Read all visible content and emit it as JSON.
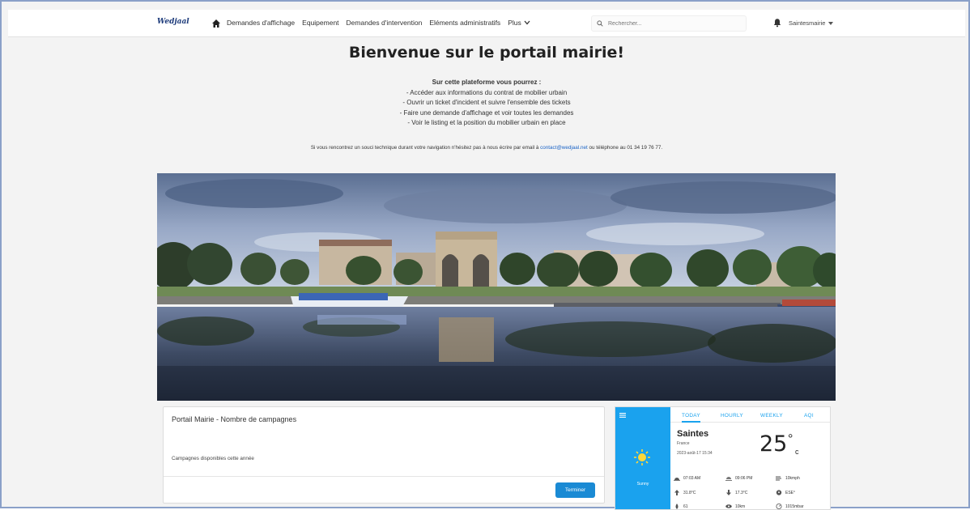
{
  "nav": {
    "logo": "Wedjaal",
    "links": [
      "Demandes d'affichage",
      "Equipement",
      "Demandes d'intervention",
      "Eléments administratifs"
    ],
    "more_label": "Plus",
    "search_placeholder": "Rechercher...",
    "user_label": "Saintesmairie"
  },
  "main": {
    "title": "Bienvenue sur le portail mairie!",
    "intro_lead": "Sur cette plateforme vous pourrez :",
    "intro_items": [
      "- Accéder aux informations du contrat de mobilier urbain",
      "- Ouvrir un ticket d'incident et suivre l'ensemble des tickets",
      "- Faire une demande d'affichage et voir toutes les demandes",
      "- Voir le listing et la position du mobilier urbain en place"
    ],
    "contact_prefix": "Si vous rencontrez un souci technique durant votre navigation n'hésitez pas à nous écrire par email à",
    "contact_email": "contact@wedjaal.net",
    "contact_suffix": "ou téléphone au 01 34 19 76 77."
  },
  "campaign_card": {
    "title": "Portail Mairie - Nombre de campagnes",
    "subtitle": "Campagnes disponibles cette année",
    "button_label": "Terminer"
  },
  "weather": {
    "tabs": [
      "TODAY",
      "HOURLY",
      "WEEKLY",
      "AQI"
    ],
    "city": "Saintes",
    "country": "France",
    "datetime": "2023-août-17 15:34",
    "temperature": "25",
    "degree_symbol": "°",
    "unit": "c",
    "condition": "Sunny",
    "stats": {
      "sunrise": "07:03 AM",
      "sunset": "09:06 PM",
      "wind": "10kmph",
      "temp_high": "31.8°C",
      "temp_low": "17.3°C",
      "direction": "ESE°",
      "humidity": "61",
      "visibility": "10km",
      "pressure": "1015mbar"
    }
  },
  "colors": {
    "accent": "#1aa2ee",
    "button": "#1a8ad4",
    "link": "#1a63c6"
  }
}
